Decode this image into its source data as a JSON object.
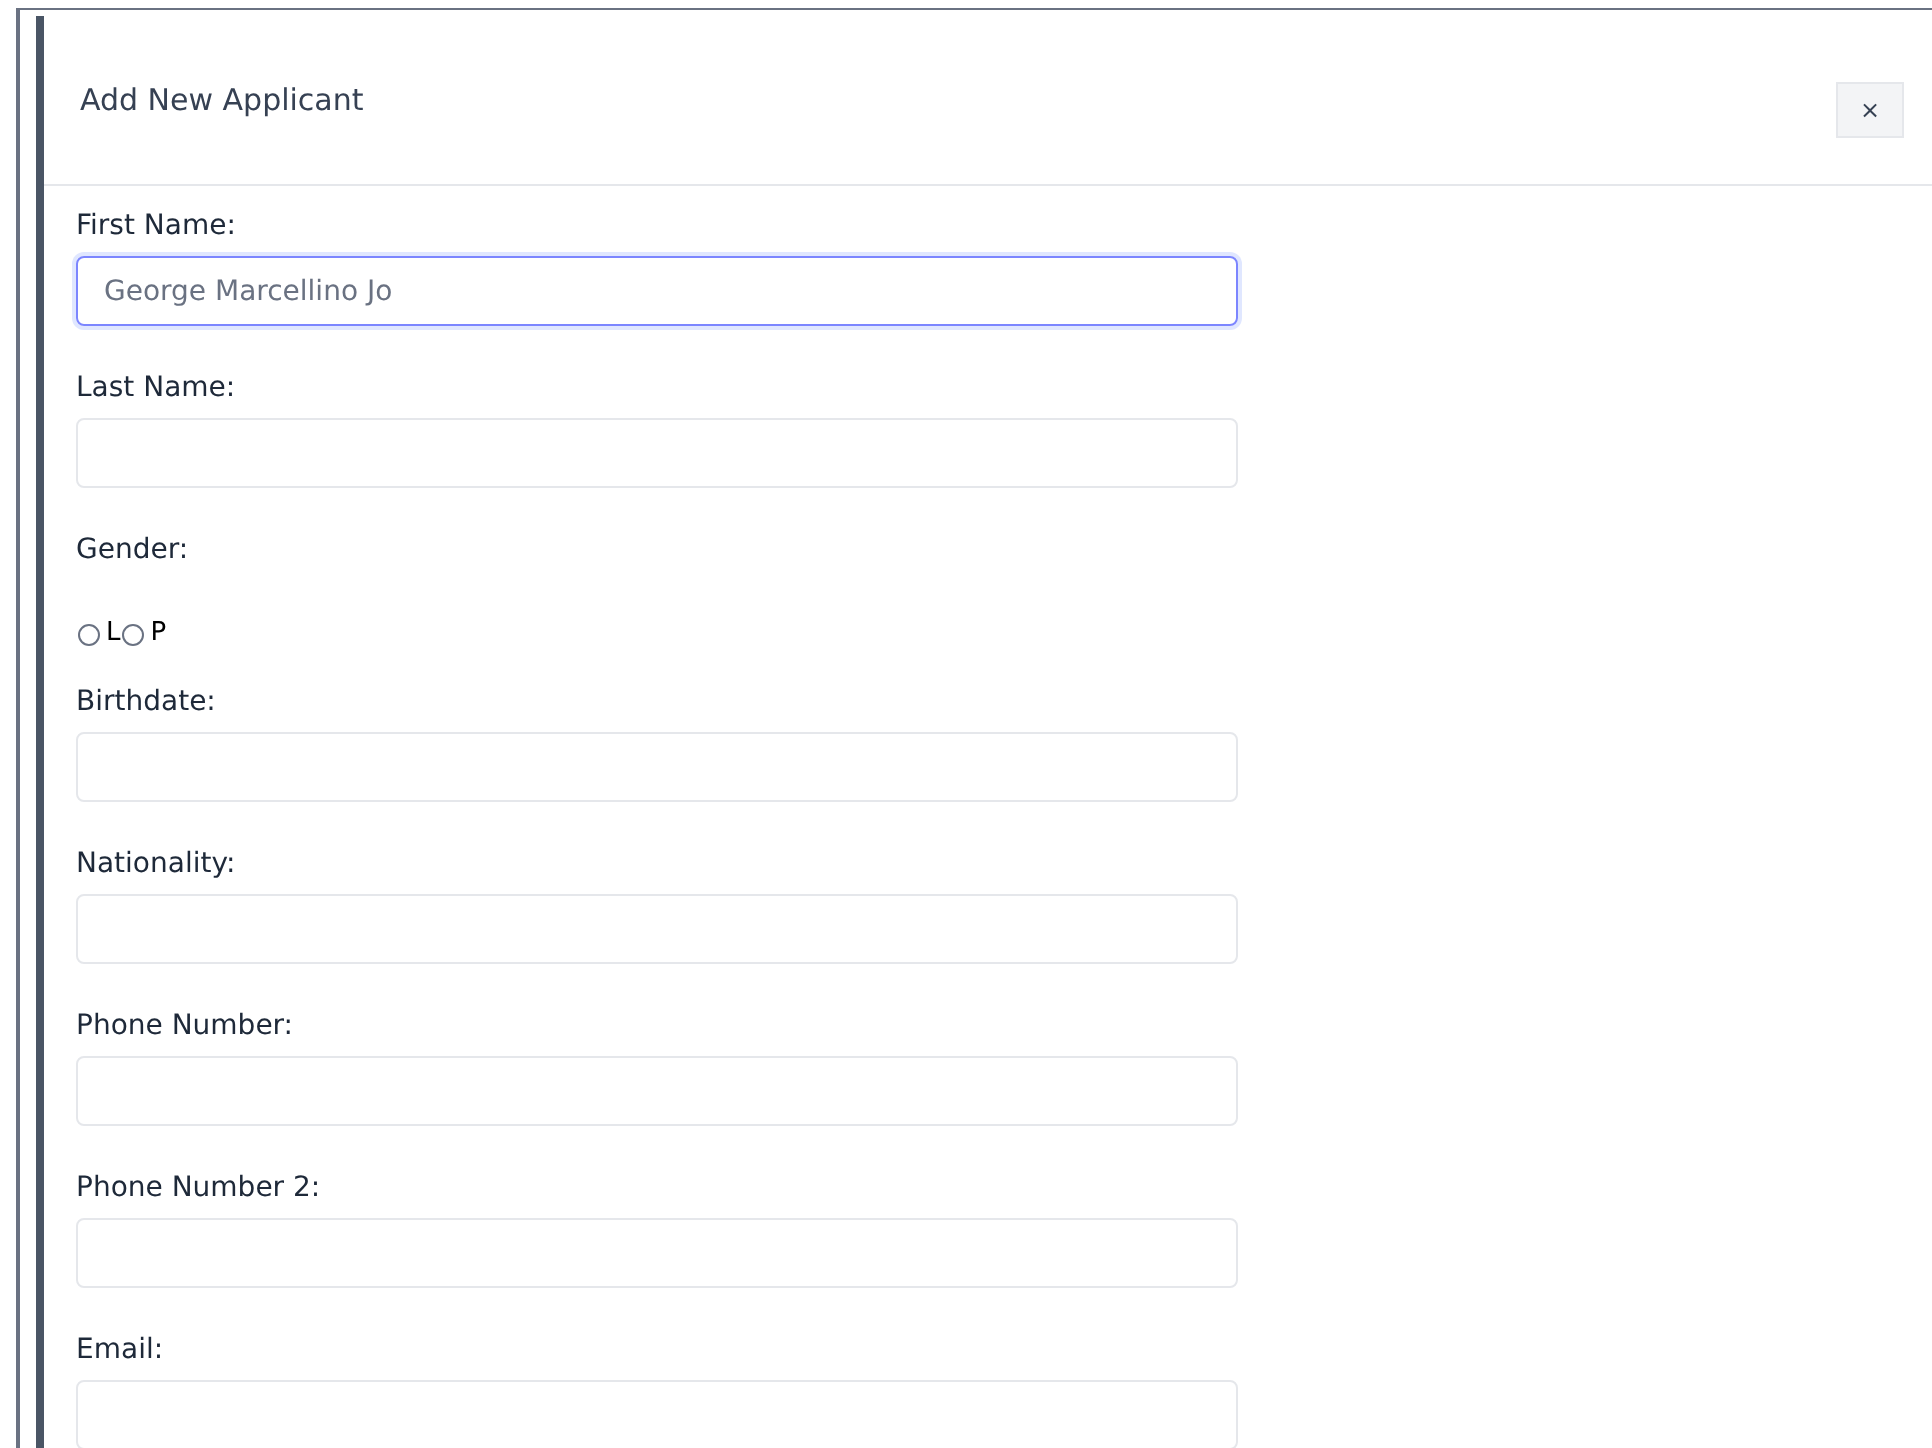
{
  "dialog": {
    "title": "Add New Applicant",
    "close_label": "×"
  },
  "fields": [
    {
      "kind": "text",
      "label": "First Name:",
      "value": "George Marcellino Jo",
      "focused": true
    },
    {
      "kind": "text",
      "label": "Last Name:",
      "focused": false
    },
    {
      "kind": "radio",
      "label": "Gender:",
      "options": [
        {
          "label": "L",
          "selected": false
        },
        {
          "label": "P",
          "selected": false
        }
      ]
    },
    {
      "kind": "text",
      "label": "Birthdate:",
      "focused": false
    },
    {
      "kind": "text",
      "label": "Nationality:",
      "focused": false
    },
    {
      "kind": "text",
      "label": "Phone Number:",
      "focused": false
    },
    {
      "kind": "text",
      "label": "Phone Number 2:",
      "focused": false
    },
    {
      "kind": "text",
      "label": "Email:",
      "focused": false
    }
  ]
}
